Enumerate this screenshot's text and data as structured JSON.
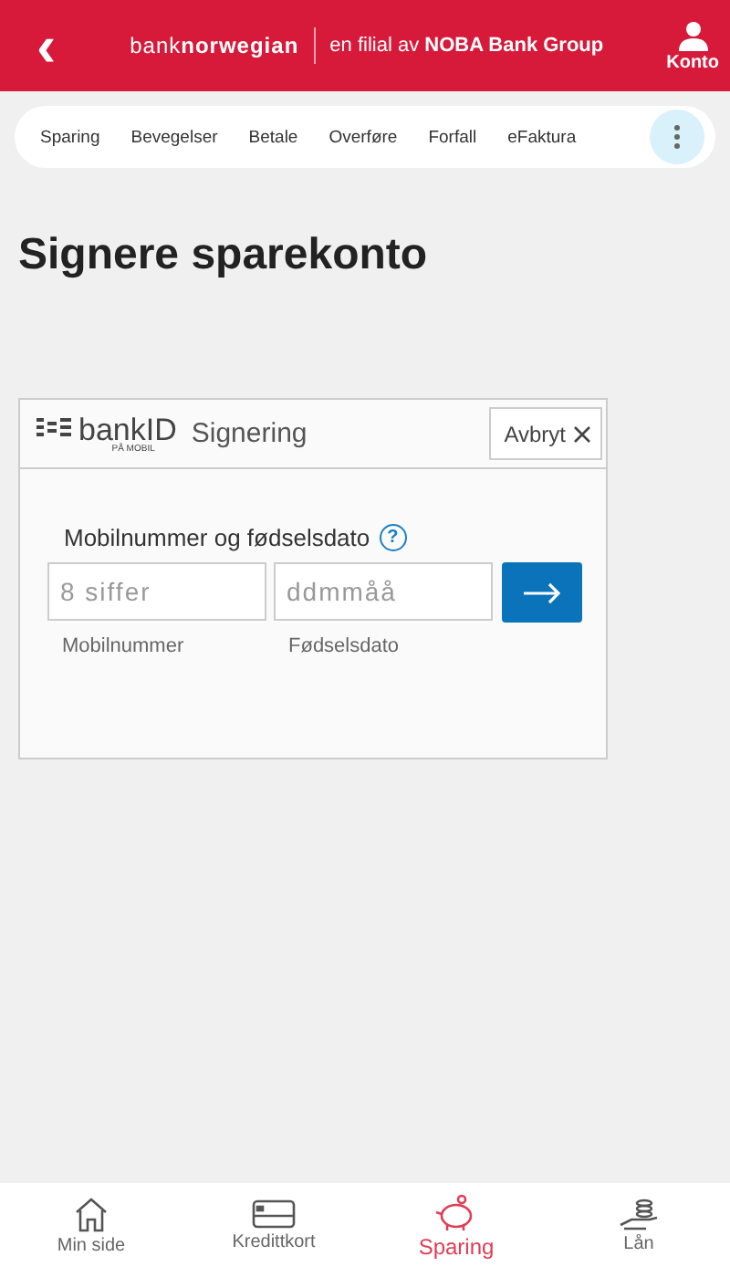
{
  "header": {
    "back": "‹",
    "brand": "bank**norwegian**",
    "tagline": "en filial av **NOBA Bank Group**",
    "account": "Konto"
  },
  "tabs": [
    {
      "label": "Sparing",
      "selected": false
    },
    {
      "label": "Bevegelser",
      "selected": false
    },
    {
      "label": "Betale",
      "selected": false
    },
    {
      "label": "Overføre",
      "selected": false
    },
    {
      "label": "Forfall",
      "selected": false
    },
    {
      "label": "eFaktura",
      "selected": false
    }
  ],
  "title": "Signere sparekonto",
  "bankid": {
    "logo": "bankID",
    "logo_sub": "PÅ MOBIL",
    "heading": "Signering",
    "cancel": "Avbryt",
    "prompt": "Mobilnummer og fødselsdato",
    "help": "?",
    "fields": [
      {
        "placeholder": "8 siffer",
        "label": "Mobilnummer"
      },
      {
        "placeholder": "ddmmåå",
        "label": "Fødselsdato"
      }
    ]
  },
  "bottom_nav": [
    {
      "label": "Min side",
      "selected": false
    },
    {
      "label": "Kredittkort",
      "selected": false
    },
    {
      "label": "Sparing",
      "selected": true
    },
    {
      "label": "Lån",
      "selected": false
    }
  ]
}
